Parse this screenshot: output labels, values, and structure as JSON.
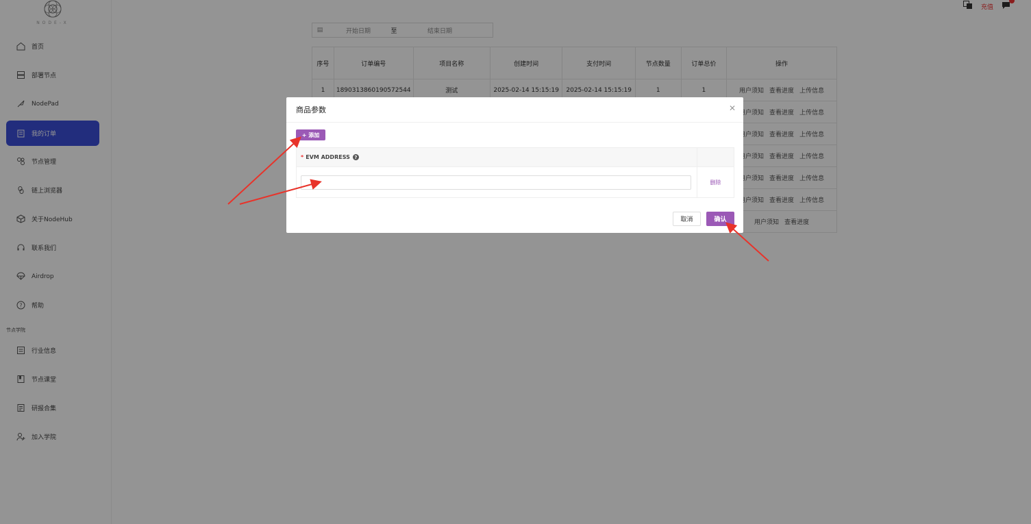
{
  "logo": {
    "text": "NODE-X"
  },
  "sidebar": {
    "items": [
      {
        "label": "首页",
        "icon": "home-icon"
      },
      {
        "label": "部署节点",
        "icon": "server-icon"
      },
      {
        "label": "NodePad",
        "icon": "rocket-icon"
      },
      {
        "label": "我的订单",
        "icon": "clipboard-icon",
        "active": true
      },
      {
        "label": "节点管理",
        "icon": "nodes-icon"
      },
      {
        "label": "链上浏览器",
        "icon": "link-icon"
      },
      {
        "label": "关于NodeHub",
        "icon": "cube-icon"
      },
      {
        "label": "联系我们",
        "icon": "headset-icon"
      },
      {
        "label": "Airdrop",
        "icon": "parachute-icon"
      },
      {
        "label": "帮助",
        "icon": "help-icon"
      }
    ],
    "section": "节点学院",
    "academy": [
      {
        "label": "行业信息",
        "icon": "news-icon"
      },
      {
        "label": "节点课堂",
        "icon": "book-icon"
      },
      {
        "label": "研报合集",
        "icon": "report-icon"
      },
      {
        "label": "加入学院",
        "icon": "user-plus-icon"
      }
    ]
  },
  "header": {
    "recharge": "充值"
  },
  "filter": {
    "start_placeholder": "开始日期",
    "separator": "至",
    "end_placeholder": "结束日期"
  },
  "orders": {
    "columns": [
      "序号",
      "订单编号",
      "项目名称",
      "创建时间",
      "支付时间",
      "节点数量",
      "订单总价",
      "操作"
    ],
    "first_row": {
      "index": "1",
      "order_no": "1890313860190572544",
      "project": "测试",
      "created": "2025-02-14 15:15:19",
      "paid": "2025-02-14 15:15:19",
      "nodes": "1",
      "total": "1"
    },
    "ops": [
      "用户须知",
      "查看进度",
      "上传信息"
    ],
    "last_ops": [
      "用户须知",
      "查看进度"
    ]
  },
  "modal": {
    "title": "商品参数",
    "add": "+ 添加",
    "field_label": "EVM ADDRESS",
    "field_value": "",
    "delete": "删除",
    "cancel": "取消",
    "confirm": "确认"
  },
  "colors": {
    "accent": "#9b59b6",
    "active_nav": "#3c4fd8",
    "arrow": "#e8332a"
  }
}
